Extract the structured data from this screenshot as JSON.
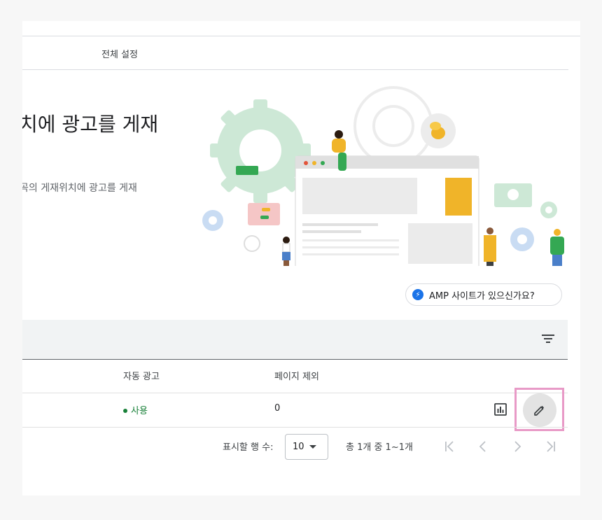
{
  "tabs": {
    "all_settings": "전체 설정"
  },
  "hero": {
    "headline": "치에 광고를 게재",
    "subline": "곡의 게재위치에 광고를 게재"
  },
  "amp_button": {
    "label": "AMP 사이트가 있으신가요?",
    "icon": "bolt-icon"
  },
  "table": {
    "columns": {
      "auto_ads": "자동 광고",
      "page_exclusions": "페이지 제외"
    },
    "rows": [
      {
        "status": "사용",
        "exclusions": "0"
      }
    ]
  },
  "pagination": {
    "rows_label": "표시할 행 수:",
    "rows_value": "10",
    "range": "총 1개 중 1~1개"
  },
  "colors": {
    "accent": "#1a73e8",
    "status_active": "#188038",
    "highlight": "#e89ac7",
    "illustration_yellow": "#f0b429",
    "illustration_green": "#cde8d6"
  }
}
